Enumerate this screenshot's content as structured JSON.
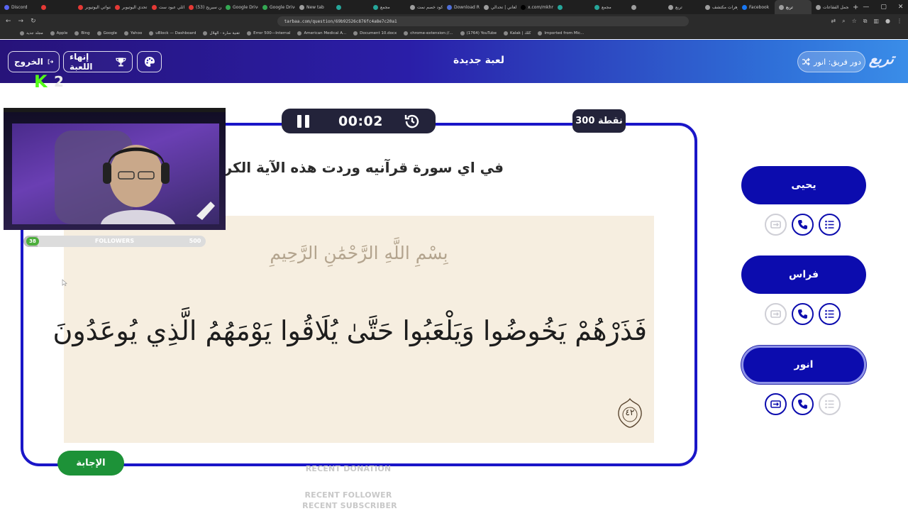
{
  "browser": {
    "tabs": [
      {
        "label": "Discord",
        "color": "#5865f2"
      },
      {
        "label": "",
        "color": "#e53935"
      },
      {
        "label": "قنواتي اليوتيوبر",
        "color": "#e53935"
      },
      {
        "label": "تحدي اليوتيوبر",
        "color": "#e53935"
      },
      {
        "label": "عائلي عبود ست",
        "color": "#e53935"
      },
      {
        "label": "(53) من سيريح",
        "color": "#e53935"
      },
      {
        "label": "Google Drive",
        "color": "#34a853"
      },
      {
        "label": "Google Drive",
        "color": "#34a853"
      },
      {
        "label": "New tab",
        "color": "#9e9e9e"
      },
      {
        "label": "",
        "color": "#26a69a"
      },
      {
        "label": "مجمع",
        "color": "#26a69a"
      },
      {
        "label": "كود خصم نمت",
        "color": "#9e9e9e"
      },
      {
        "label": "Download Roli",
        "color": "#4f6fd8"
      },
      {
        "label": "العاني | تحدالي",
        "color": "#9e9e9e"
      },
      {
        "label": "x.com/mkhmi",
        "color": "#000000"
      },
      {
        "label": "",
        "color": "#26a69a"
      },
      {
        "label": "مجمع",
        "color": "#26a69a"
      },
      {
        "label": "",
        "color": "#9e9e9e"
      },
      {
        "label": "تربع",
        "color": "#9e9e9e"
      },
      {
        "label": "جرهرات مكتشف",
        "color": "#9e9e9e"
      },
      {
        "label": "Facebook",
        "color": "#1877f2"
      },
      {
        "label": "تربع",
        "color": "#9e9e9e",
        "active": true
      },
      {
        "label": "مجمل الفقاعات",
        "color": "#9e9e9e"
      }
    ],
    "new_tab": "+",
    "window_controls": [
      "—",
      "▢",
      "✕"
    ],
    "url": "tarbaa.com/question/69b92526c876fc4a8e7c20a1",
    "bookmarks": [
      "مجلد جديد",
      "Apple",
      "Bing",
      "Google",
      "Yahoo",
      "uBlock — Dashboard",
      "تقنية سارة - الهلال",
      "Error 500—Internal",
      "American Medical A...",
      "Document 10.docx",
      "chrome-extension://...",
      "(1764) YouTube",
      "Kalak | كلك",
      "Imported from Mic..."
    ]
  },
  "header": {
    "exit_label": "الخروج",
    "end_game_label": "إنهاء اللعبة",
    "title": "لعبة جديدة",
    "turn_label": "دور فريق: انور",
    "logo": "تربع"
  },
  "game": {
    "timer": "00:02",
    "points": "300 نقطة",
    "question": "في اي سورة قرآنيه وردت هذه الآية الكريمة",
    "basmala": "بِسْمِ اللَّهِ الرَّحْمَٰنِ الرَّحِيمِ",
    "verse": "فَذَرْهُمْ يَخُوضُوا وَيَلْعَبُوا حَتَّىٰ يُلَاقُوا يَوْمَهُمُ الَّذِي يُوعَدُونَ",
    "verse_number": "٤٢",
    "answer_label": "الإجابة"
  },
  "teams": [
    {
      "name": "يحيى",
      "active": false,
      "tools": {
        "swap": false,
        "call": true,
        "list": true
      }
    },
    {
      "name": "فراس",
      "active": false,
      "tools": {
        "swap": false,
        "call": true,
        "list": true
      }
    },
    {
      "name": "انور",
      "active": true,
      "tools": {
        "swap": true,
        "call": true,
        "list": false
      }
    }
  ],
  "stream": {
    "kick_count": "2",
    "followers_label": "FOLLOWERS",
    "followers_current": "38",
    "followers_goal": "500",
    "followers_progress": 0.076,
    "recent_donation": "RECENT DONATION",
    "recent_follower": "RECENT FOLLOWER",
    "recent_subscriber": "RECENT SUBSCRIBER"
  },
  "colors": {
    "accent": "#1a16c8",
    "team_button": "#0c0cae",
    "answer_button": "#1d9238",
    "kick_green": "#53fc18"
  }
}
